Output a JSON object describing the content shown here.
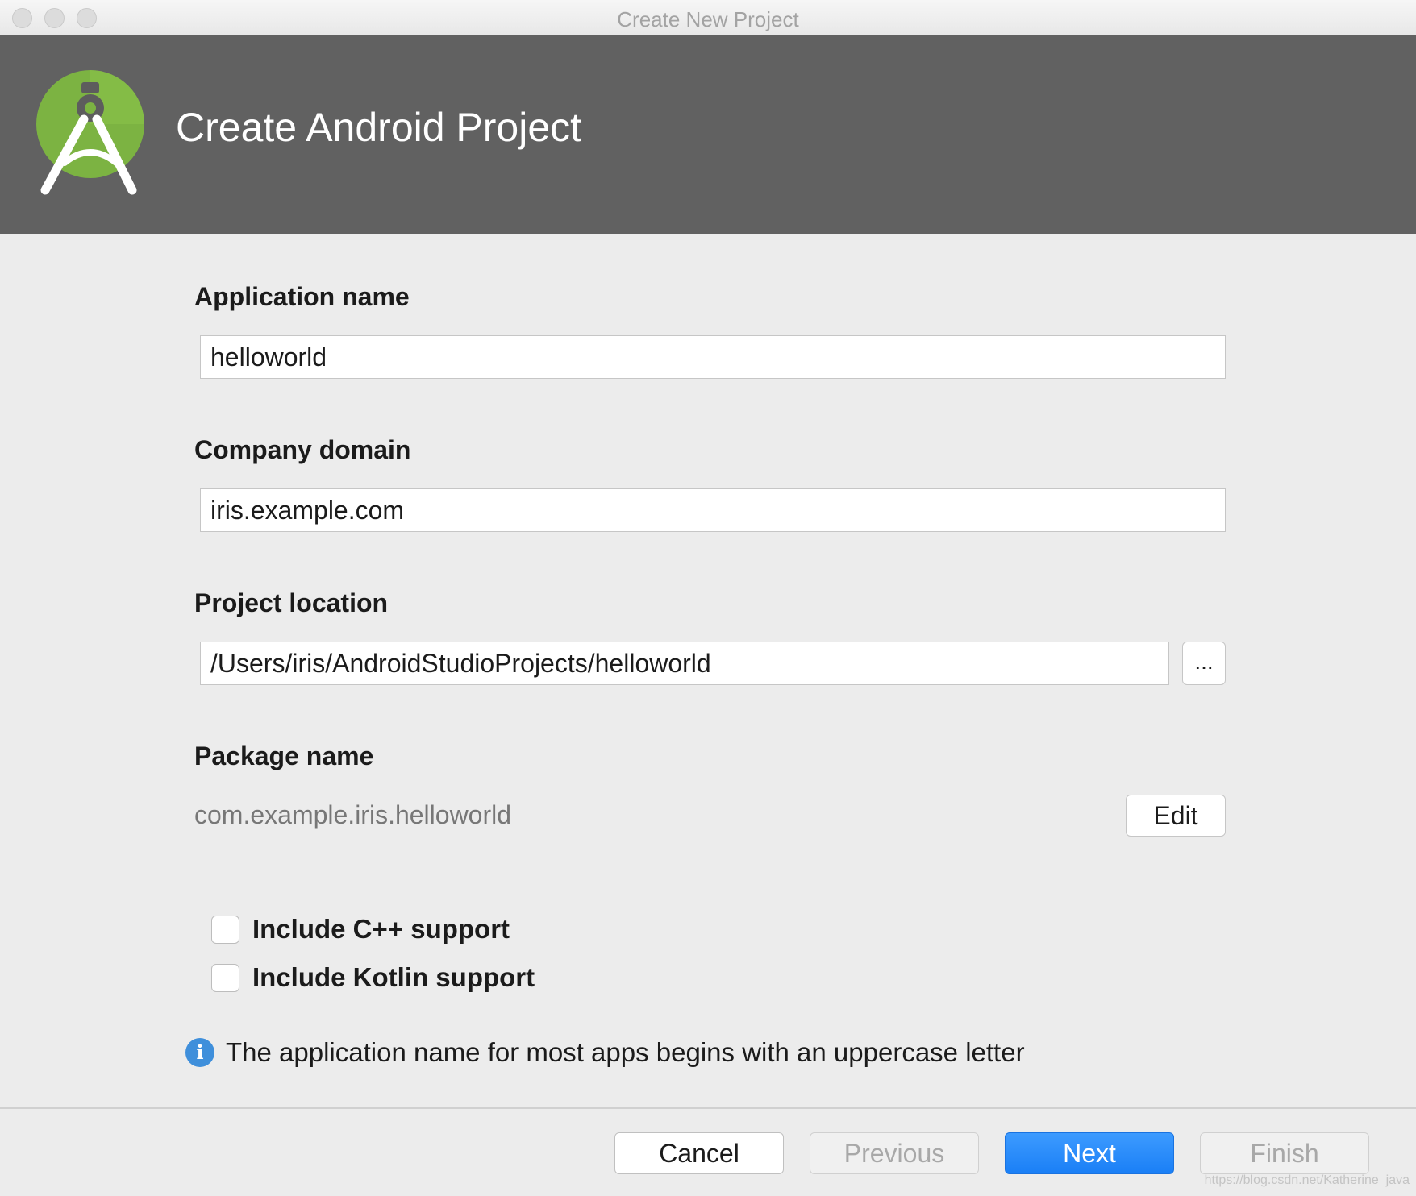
{
  "window": {
    "title": "Create New Project"
  },
  "header": {
    "title": "Create Android Project",
    "logo_icon": "android-studio-logo-icon"
  },
  "form": {
    "application_name": {
      "label": "Application name",
      "value": "helloworld"
    },
    "company_domain": {
      "label": "Company domain",
      "value": "iris.example.com"
    },
    "project_location": {
      "label": "Project location",
      "value": "/Users/iris/AndroidStudioProjects/helloworld",
      "browse_label": "..."
    },
    "package_name": {
      "label": "Package name",
      "value": "com.example.iris.helloworld",
      "edit_label": "Edit"
    },
    "include_cpp": {
      "label": "Include C++ support",
      "checked": false
    },
    "include_kotlin": {
      "label": "Include Kotlin support",
      "checked": false
    }
  },
  "info": {
    "icon": "info-icon",
    "message": "The application name for most apps begins with an uppercase letter"
  },
  "footer": {
    "cancel_label": "Cancel",
    "previous_label": "Previous",
    "next_label": "Next",
    "finish_label": "Finish"
  },
  "watermark": "https://blog.csdn.net/Katherine_java",
  "colors": {
    "header_bg": "#616161",
    "android_green": "#7cb342",
    "primary_button": "#1a7ff6",
    "info_icon": "#3f8fdb"
  }
}
